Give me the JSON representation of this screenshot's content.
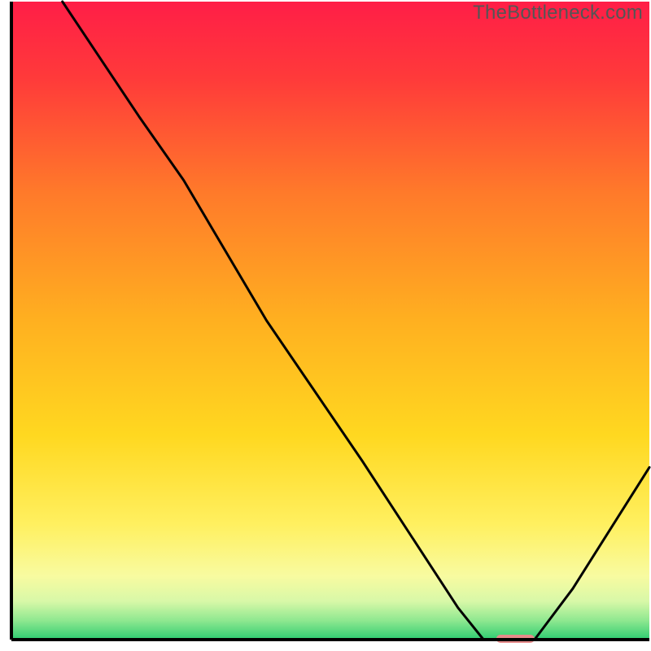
{
  "watermark": "TheBottleneck.com",
  "chart_data": {
    "type": "line",
    "title": "",
    "xlabel": "",
    "ylabel": "",
    "xlim": [
      0,
      100
    ],
    "ylim": [
      0,
      100
    ],
    "x": [
      8,
      20,
      27,
      40,
      55,
      70,
      74,
      78,
      82,
      88,
      100
    ],
    "values": [
      100,
      82,
      72,
      50,
      28,
      5,
      0,
      0,
      0,
      8,
      27
    ],
    "marker": {
      "x_start": 76,
      "x_end": 82,
      "y": 0,
      "color": "#E68A8A"
    },
    "gradient_stops": [
      {
        "offset": 0.0,
        "color": "#FF1E47"
      },
      {
        "offset": 0.12,
        "color": "#FF3A3A"
      },
      {
        "offset": 0.3,
        "color": "#FF7A2A"
      },
      {
        "offset": 0.5,
        "color": "#FFB020"
      },
      {
        "offset": 0.68,
        "color": "#FFD820"
      },
      {
        "offset": 0.82,
        "color": "#FFF060"
      },
      {
        "offset": 0.9,
        "color": "#F8FBA0"
      },
      {
        "offset": 0.94,
        "color": "#D8F8A8"
      },
      {
        "offset": 0.97,
        "color": "#8FE890"
      },
      {
        "offset": 1.0,
        "color": "#2ECC71"
      }
    ],
    "axis_color": "#000000",
    "line_color": "#000000"
  }
}
